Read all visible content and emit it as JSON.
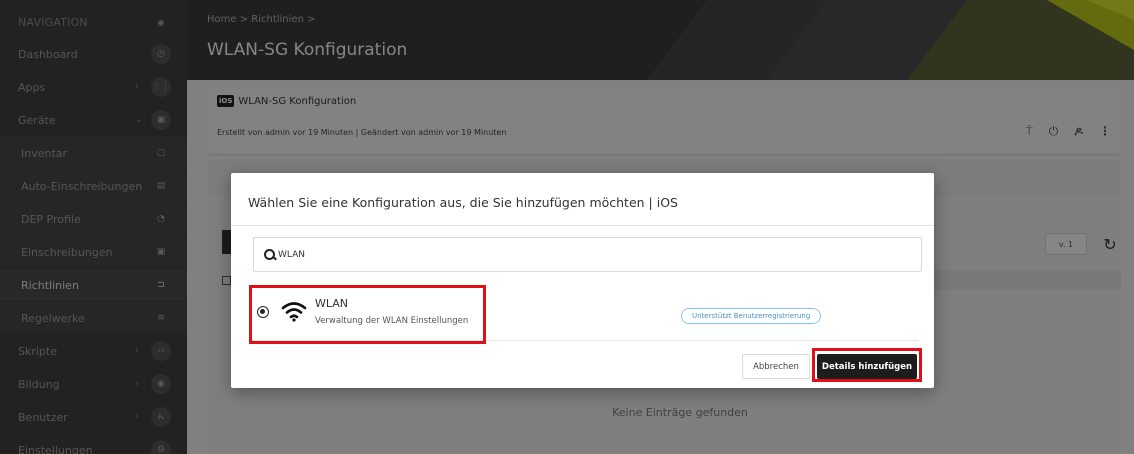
{
  "sidebar": {
    "header": "NAVIGATION",
    "items": [
      {
        "label": "Dashboard",
        "icon": "dashboard-icon",
        "glyph": "◷"
      },
      {
        "label": "Apps",
        "icon": "apps-grid-icon",
        "glyph": "⋮⋮"
      },
      {
        "label": "Geräte",
        "icon": "devices-icon",
        "glyph": "▣"
      },
      {
        "label": "Inventar",
        "icon": "inventory-icon",
        "glyph": "▢"
      },
      {
        "label": "Auto-Einschreibungen",
        "icon": "auto-enroll-icon",
        "glyph": "▤"
      },
      {
        "label": "DEP Profile",
        "icon": "dep-profile-icon",
        "glyph": "◔"
      },
      {
        "label": "Einschreibungen",
        "icon": "enrollments-icon",
        "glyph": "▣"
      },
      {
        "label": "Richtlinien",
        "icon": "policies-icon",
        "glyph": "⊐"
      },
      {
        "label": "Regelwerke",
        "icon": "rulesets-icon",
        "glyph": "≡"
      },
      {
        "label": "Skripte",
        "icon": "scripts-icon",
        "glyph": "‹›"
      },
      {
        "label": "Bildung",
        "icon": "education-icon",
        "glyph": "◉"
      },
      {
        "label": "Benutzer",
        "icon": "users-icon",
        "glyph": "ኡ"
      },
      {
        "label": "Einstellungen",
        "icon": "settings-icon",
        "glyph": "⚙"
      }
    ]
  },
  "header": {
    "breadcrumb": "Home > Richtlinien >",
    "title": "WLAN-SG Konfiguration"
  },
  "card": {
    "badge": "iOS",
    "title": "WLAN-SG Konfiguration",
    "meta": "Erstellt von admin vor 19 Minuten  |  Geändert von admin vor 19 Minuten"
  },
  "content": {
    "version": "v. 1",
    "empty": "Keine Einträge gefunden"
  },
  "modal": {
    "title": "Wählen Sie eine Konfiguration aus, die Sie hinzufügen möchten | iOS",
    "search_value": "WLAN",
    "result": {
      "title": "WLAN",
      "description": "Verwaltung der WLAN Einstellungen",
      "pill": "Unterstützt Benutzerregistrierung"
    },
    "cancel_label": "Abbrechen",
    "submit_label": "Details hinzufügen"
  },
  "colors": {
    "highlight": "#e0101b",
    "accent": "#c8d400",
    "primary_button": "#1d1d1d"
  }
}
